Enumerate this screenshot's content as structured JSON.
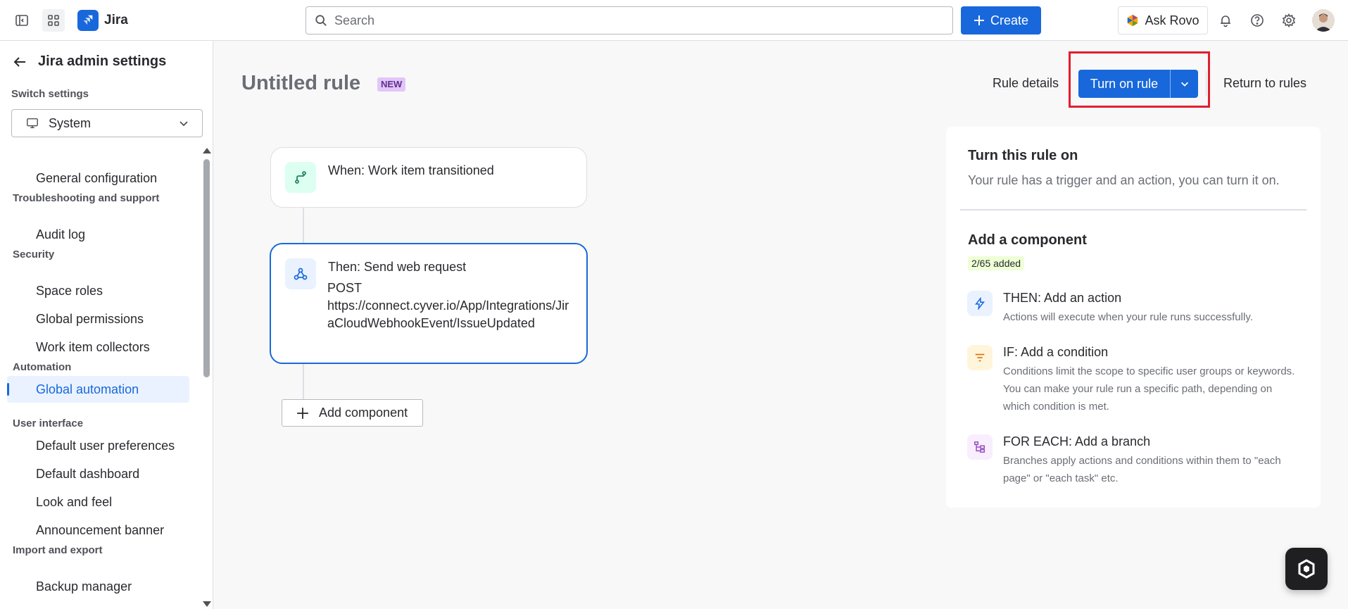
{
  "app": {
    "name": "Jira"
  },
  "topbar": {
    "search_placeholder": "Search",
    "create_label": "Create",
    "rovo_label": "Ask Rovo"
  },
  "sidebar": {
    "title": "Jira admin settings",
    "switch_label": "Switch settings",
    "switch_value": "System",
    "groups": [
      {
        "label": "Troubleshooting and support"
      },
      {
        "label": "Security"
      },
      {
        "label": "Automation"
      },
      {
        "label": "User interface"
      },
      {
        "label": "Import and export"
      }
    ],
    "items": [
      {
        "label": "General configuration"
      },
      {
        "label": "Audit log"
      },
      {
        "label": "Space roles"
      },
      {
        "label": "Global permissions"
      },
      {
        "label": "Work item collectors"
      },
      {
        "label": "Global automation"
      },
      {
        "label": "Default user preferences"
      },
      {
        "label": "Default dashboard"
      },
      {
        "label": "Look and feel"
      },
      {
        "label": "Announcement banner"
      },
      {
        "label": "Backup manager"
      }
    ]
  },
  "header": {
    "rule_title": "Untitled rule",
    "badge": "NEW",
    "rule_details": "Rule details",
    "turn_on": "Turn on rule",
    "return": "Return to rules"
  },
  "flow": {
    "trigger_title": "When: Work item transitioned",
    "action_title": "Then: Send web request",
    "action_method": "POST",
    "action_url": "https://connect.cyver.io/App/Integrations/JiraCloudWebhookEvent/IssueUpdated",
    "add_component": "Add component"
  },
  "panel": {
    "heading": "Turn this rule on",
    "subtext": "Your rule has a trigger and an action, you can turn it on.",
    "add_heading": "Add a component",
    "count": "2/65 added",
    "components": [
      {
        "title": "THEN: Add an action",
        "desc": "Actions will execute when your rule runs successfully."
      },
      {
        "title": "IF: Add a condition",
        "desc": "Conditions limit the scope to specific user groups or keywords. You can make your rule run a specific path, depending on which condition is met."
      },
      {
        "title": "FOR EACH: Add a branch",
        "desc": "Branches apply actions and conditions within them to \"each page\" or \"each task\" etc."
      }
    ]
  },
  "colors": {
    "brand": "#1868db",
    "highlight": "#e01f2e",
    "badge_new": "#e2c6f7",
    "count_bg": "#efffd6"
  },
  "icons": [
    "sidebar-toggle-icon",
    "app-switcher-icon",
    "jira-logo-icon",
    "search-icon",
    "plus-icon",
    "rovo-icon",
    "bell-icon",
    "help-icon",
    "gear-icon",
    "back-arrow-icon",
    "monitor-icon",
    "chevron-down-icon",
    "branch-trigger-icon",
    "webhook-icon",
    "lightning-icon",
    "filter-icon",
    "branch-icon",
    "rovo-chat-icon"
  ]
}
